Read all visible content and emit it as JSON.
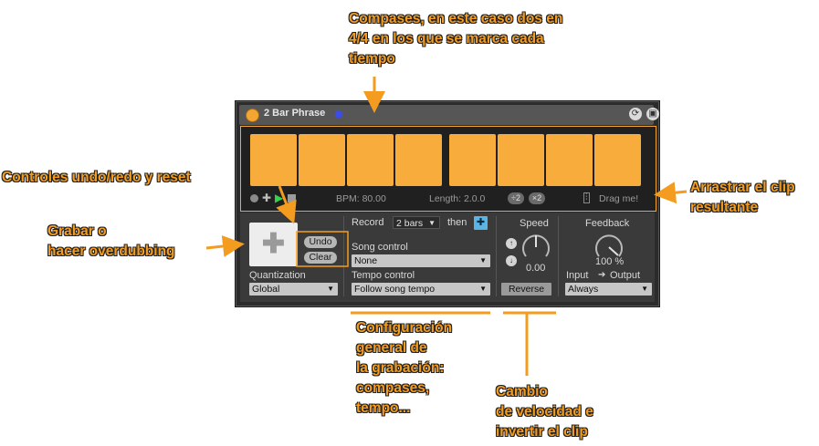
{
  "annotations": {
    "top": [
      "Compases, en este caso dos en",
      "4/4 en los que se marca cada",
      "tiempo"
    ],
    "undo_redo": "Controles undo/redo y reset",
    "record": [
      "Grabar o",
      "hacer overdubbing"
    ],
    "drag": [
      "Arrastrar el clip",
      "resultante"
    ],
    "config": [
      "Configuración",
      "general de",
      "la grabación:",
      "compases,",
      "tempo..."
    ],
    "speed": [
      "Cambio",
      "de velocidad e",
      "invertir el clip"
    ]
  },
  "device": {
    "title": "2 Bar Phrase",
    "blue_mark": "⬢",
    "status": {
      "bpm": "BPM: 80.00",
      "length": "Length: 2.0.0",
      "half": "÷2",
      "double": "×2",
      "drag": "Drag me!"
    },
    "record_button": "✚",
    "undo": "Undo",
    "clear": "Clear",
    "quantization_label": "Quantization",
    "quantization_value": "Global",
    "record_label": "Record",
    "record_bars": "2 bars",
    "then_label": "then",
    "then_icon": "✚",
    "song_control_label": "Song control",
    "song_control_value": "None",
    "tempo_control_label": "Tempo control",
    "tempo_control_value": "Follow song tempo",
    "speed_label": "Speed",
    "speed_value": "0.00",
    "up_icon": "↑",
    "down_icon": "↓",
    "reverse": "Reverse",
    "feedback_label": "Feedback",
    "feedback_value": "100 %",
    "input_label": "Input",
    "output_label": "Output",
    "io_arrow": "➔",
    "always_value": "Always"
  },
  "colors": {
    "accent": "#f3a634",
    "pad": "#f8ac3c",
    "device_bg": "#2b2b2b",
    "annotation": "#f39c1f"
  }
}
